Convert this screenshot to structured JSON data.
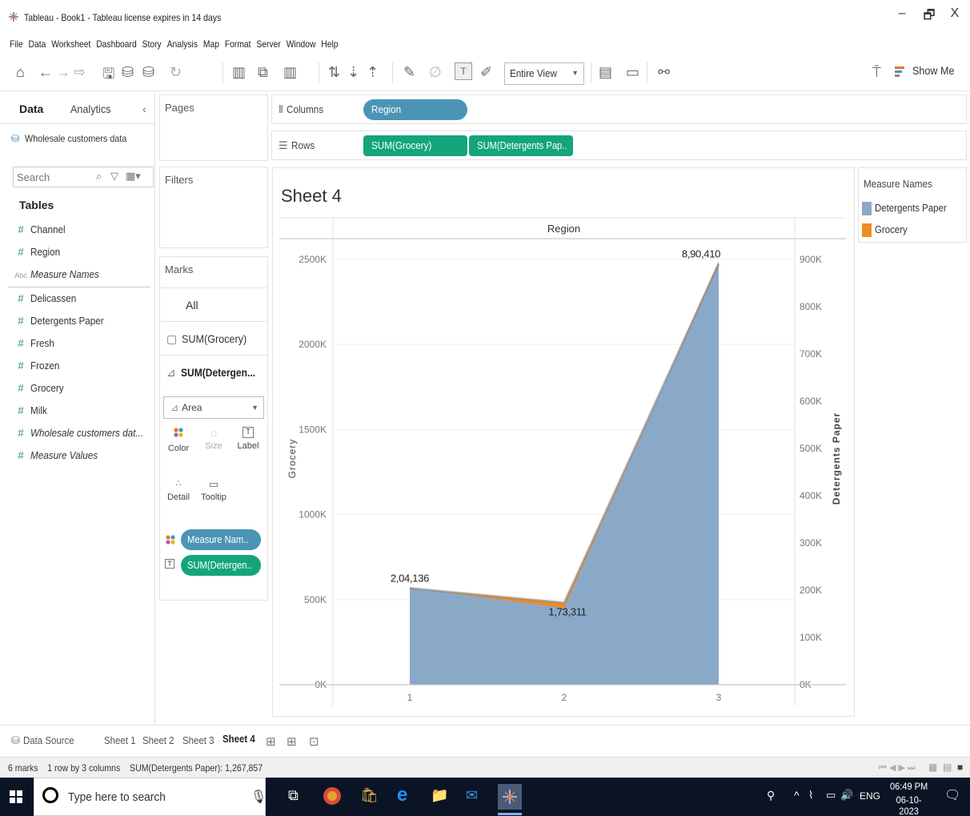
{
  "window": {
    "title": "Tableau - Book1 - Tableau license expires in 14 days",
    "minimize": "–",
    "maximize": "🗗",
    "close": "X"
  },
  "menu": [
    "File",
    "Data",
    "Worksheet",
    "Dashboard",
    "Story",
    "Analysis",
    "Map",
    "Format",
    "Server",
    "Window",
    "Help"
  ],
  "toolbar": {
    "view_fit": "Entire View",
    "show_me": "Show Me"
  },
  "datapane": {
    "tab_data": "Data",
    "tab_analytics": "Analytics",
    "collapse": "‹",
    "datasource": "Wholesale customers data",
    "search_placeholder": "Search",
    "tables_heading": "Tables",
    "fields": [
      {
        "type": "#",
        "name": "Channel"
      },
      {
        "type": "#",
        "name": "Region"
      },
      {
        "type": "Abc",
        "name": "Measure Names"
      },
      {
        "type": "#",
        "name": "Delicassen"
      },
      {
        "type": "#",
        "name": "Detergents Paper"
      },
      {
        "type": "#",
        "name": "Fresh"
      },
      {
        "type": "#",
        "name": "Frozen"
      },
      {
        "type": "#",
        "name": "Grocery"
      },
      {
        "type": "#",
        "name": "Milk"
      },
      {
        "type": "#",
        "name": "Wholesale customers dat..."
      },
      {
        "type": "#",
        "name": "Measure Values"
      }
    ]
  },
  "cards": {
    "pages": "Pages",
    "filters": "Filters",
    "marks": "Marks",
    "marks_all": "All",
    "marks_grocery": "SUM(Grocery)",
    "marks_detergents": "SUM(Detergen...",
    "mark_type": "Area",
    "color": "Color",
    "size": "Size",
    "label": "Label",
    "detail": "Detail",
    "tooltip": "Tooltip",
    "pill_measure_names": "Measure Nam..",
    "pill_sum_detergents": "SUM(Detergen.."
  },
  "shelves": {
    "columns_label": "Columns",
    "rows_label": "Rows",
    "columns_pill": "Region",
    "rows_pill_1": "SUM(Grocery)",
    "rows_pill_2": "SUM(Detergents Pap.."
  },
  "legend": {
    "title": "Measure Names",
    "items": [
      {
        "name": "Detergents Paper",
        "color": "#8aa9c8"
      },
      {
        "name": "Grocery",
        "color": "#f08a24"
      }
    ]
  },
  "chart_data": {
    "type": "area",
    "title": "Sheet 4",
    "header": "Region",
    "xlabel": "",
    "x": [
      "1",
      "2",
      "3"
    ],
    "y_left_label": "Grocery",
    "y_left_ticks": [
      "0K",
      "500K",
      "1000K",
      "1500K",
      "2000K",
      "2500K"
    ],
    "y_left_range": [
      0,
      2500000
    ],
    "y_right_label": "Detergents Paper",
    "y_right_ticks": [
      "0K",
      "100K",
      "200K",
      "300K",
      "400K",
      "500K",
      "600K",
      "700K",
      "800K",
      "900K"
    ],
    "y_right_range": [
      0,
      900000
    ],
    "series": [
      {
        "name": "Grocery",
        "color": "#f08a24",
        "axis": "left",
        "values": [
          570000,
          450000,
          2490000
        ]
      },
      {
        "name": "Detergents Paper",
        "color": "#8aa9c8",
        "axis": "right",
        "values": [
          204136,
          173311,
          890410
        ]
      }
    ],
    "data_labels": [
      "2,04,136",
      "1,73,311",
      "8,90,410"
    ]
  },
  "sheets": {
    "data_source": "Data Source",
    "tabs": [
      "Sheet 1",
      "Sheet 2",
      "Sheet 3",
      "Sheet 4"
    ],
    "active": "Sheet 4"
  },
  "status": {
    "marks": "6 marks",
    "dims": "1 row by 3 columns",
    "sum": "SUM(Detergents Paper): 1,267,857"
  },
  "taskbar": {
    "search_placeholder": "Type here to search",
    "lang": "ENG",
    "time": "06:49 PM",
    "date": "06-10-2023"
  }
}
